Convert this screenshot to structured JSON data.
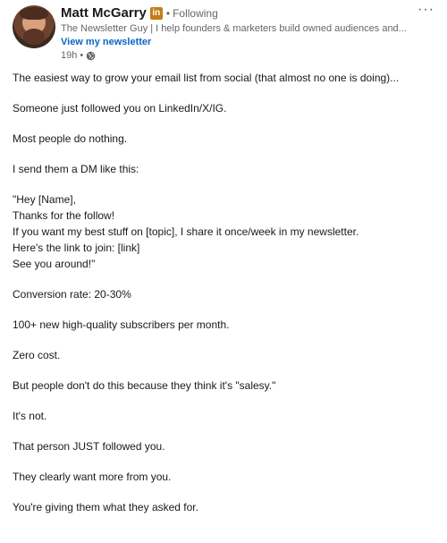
{
  "author": {
    "name": "Matt McGarry",
    "badge": "in",
    "following": "Following",
    "headline": "The Newsletter Guy | I help founders & marketers build owned audiences and...",
    "newsletter_link": "View my newsletter",
    "time": "19h",
    "visibility_icon": "globe-icon"
  },
  "menu": {
    "more": "···"
  },
  "post": {
    "p1": "The easiest way to grow your email list from social (that almost no one is doing)...",
    "p2": "Someone just followed you on LinkedIn/X/IG.",
    "p3": "Most people do nothing.",
    "p4": "I send them a DM like this:",
    "quote": [
      "\"Hey [Name],",
      "Thanks for the follow!",
      "If you want my best stuff on [topic], I share it once/week in my newsletter.",
      "Here's the link to join: [link]",
      "See you around!\""
    ],
    "p5": "Conversion rate: 20-30%",
    "p6": "100+ new high-quality subscribers per month.",
    "p7": "Zero cost.",
    "p8": "But people don't do this because they think it's \"salesy.\"",
    "p9": "It's not.",
    "p10": "That person JUST followed you.",
    "p11": "They clearly want more from you.",
    "p12": "You're giving them what they asked for."
  },
  "colors": {
    "link": "#0a66c2",
    "secondary_text": "#666666",
    "badge": "#c37d16"
  }
}
